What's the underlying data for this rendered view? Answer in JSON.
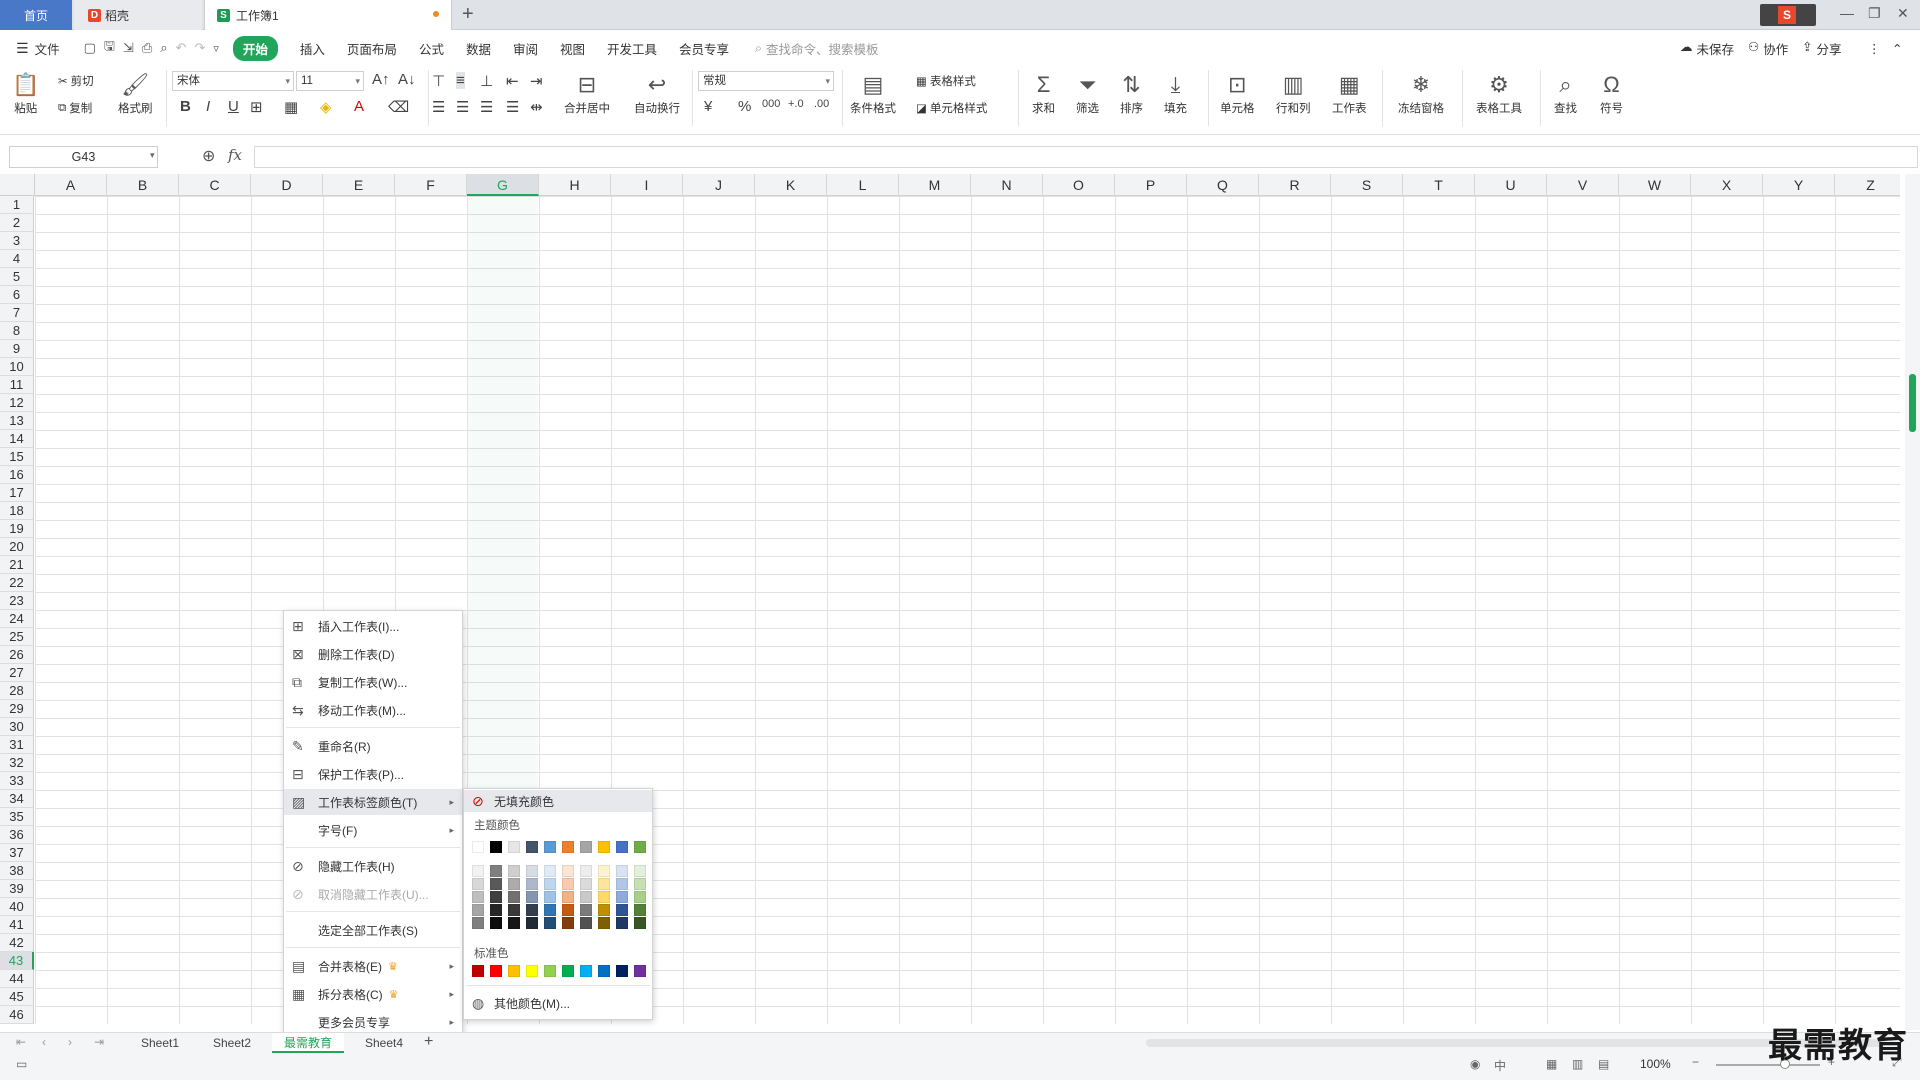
{
  "tabs": {
    "home": "首页",
    "doc": "稻壳",
    "book": "工作簿1",
    "new_tab": "+"
  },
  "menu": {
    "file": "文件",
    "items": [
      "开始",
      "插入",
      "页面布局",
      "公式",
      "数据",
      "审阅",
      "视图",
      "开发工具",
      "会员专享"
    ],
    "search": "查找命令、搜索模板",
    "unsaved": "未保存",
    "collab": "协作",
    "share": "分享"
  },
  "ribbon": {
    "paste": "粘贴",
    "cut": "剪切",
    "copy": "复制",
    "format_painter": "格式刷",
    "font": "宋体",
    "size": "11",
    "merge": "合并居中",
    "wrap": "自动换行",
    "number_format": "常规",
    "cond_format": "条件格式",
    "table_style": "表格样式",
    "cell_style": "单元格样式",
    "sum": "求和",
    "filter": "筛选",
    "sort": "排序",
    "fill": "填充",
    "cell": "单元格",
    "rowcol": "行和列",
    "sheet": "工作表",
    "freeze": "冻结窗格",
    "table_tools": "表格工具",
    "find": "查找",
    "symbol": "符号"
  },
  "formula": {
    "cell_ref": "G43",
    "fx": "fx"
  },
  "columns": [
    "A",
    "B",
    "C",
    "D",
    "E",
    "F",
    "G",
    "H",
    "I",
    "J",
    "K",
    "L",
    "M",
    "N",
    "O",
    "P",
    "Q",
    "R",
    "S",
    "T",
    "U",
    "V",
    "W",
    "X",
    "Y",
    "Z"
  ],
  "active_col": "G",
  "active_row": "43",
  "rows": [
    "1",
    "2",
    "3",
    "4",
    "5",
    "6",
    "7",
    "8",
    "9",
    "10",
    "11",
    "12",
    "13",
    "14",
    "15",
    "16",
    "17",
    "18",
    "19",
    "20",
    "21",
    "22",
    "23",
    "24",
    "25",
    "26",
    "27",
    "28",
    "29",
    "30",
    "31",
    "32",
    "33",
    "34",
    "35",
    "36",
    "37",
    "38",
    "39",
    "40",
    "41",
    "42",
    "43",
    "44",
    "45",
    "46"
  ],
  "context_menu": {
    "insert": "插入工作表(I)...",
    "delete": "删除工作表(D)",
    "copy": "复制工作表(W)...",
    "move": "移动工作表(M)...",
    "rename": "重命名(R)",
    "protect": "保护工作表(P)...",
    "tab_color": "工作表标签颜色(T)",
    "font_size": "字号(F)",
    "hide": "隐藏工作表(H)",
    "unhide": "取消隐藏工作表(U)...",
    "select_all": "选定全部工作表(S)",
    "merge": "合并表格(E)",
    "split": "拆分表格(C)",
    "more": "更多会员专享"
  },
  "color_menu": {
    "no_fill": "无填充颜色",
    "theme_title": "主题颜色",
    "standard_title": "标准色",
    "more": "其他颜色(M)...",
    "theme_top": [
      "#ffffff",
      "#000000",
      "#e7e6e6",
      "#44546a",
      "#5b9bd5",
      "#ed7d31",
      "#a5a5a5",
      "#ffc000",
      "#4472c4",
      "#70ad47"
    ],
    "theme_shades": [
      [
        "#f2f2f2",
        "#7f7f7f",
        "#d0cece",
        "#d6dce4",
        "#deebf6",
        "#fbe5d5",
        "#ededed",
        "#fff2cc",
        "#d9e2f3",
        "#e2efd9"
      ],
      [
        "#d8d8d8",
        "#595959",
        "#aeabab",
        "#adb9ca",
        "#bdd7ee",
        "#f7cbac",
        "#dbdbdb",
        "#fee599",
        "#b4c6e7",
        "#c5e0b3"
      ],
      [
        "#bfbfbf",
        "#3f3f3f",
        "#757070",
        "#8496b0",
        "#9dc3e6",
        "#f4b183",
        "#c9c9c9",
        "#ffd966",
        "#8eaadb",
        "#a8d08d"
      ],
      [
        "#a5a5a5",
        "#262626",
        "#3a3838",
        "#323f4f",
        "#2e75b5",
        "#c55a11",
        "#7b7b7b",
        "#bf9000",
        "#2f5496",
        "#538135"
      ],
      [
        "#7f7f7f",
        "#0c0c0c",
        "#171616",
        "#222a35",
        "#1e4e79",
        "#833c0b",
        "#525252",
        "#7f6000",
        "#1f3864",
        "#375623"
      ]
    ],
    "standard": [
      "#c00000",
      "#ff0000",
      "#ffc000",
      "#ffff00",
      "#92d050",
      "#00b050",
      "#00b0f0",
      "#0070c0",
      "#002060",
      "#7030a0"
    ]
  },
  "sheets": [
    "Sheet1",
    "Sheet2",
    "最需教育",
    "Sheet4"
  ],
  "active_sheet": "最需教育",
  "zoom": "100%",
  "watermark": "最需教育"
}
